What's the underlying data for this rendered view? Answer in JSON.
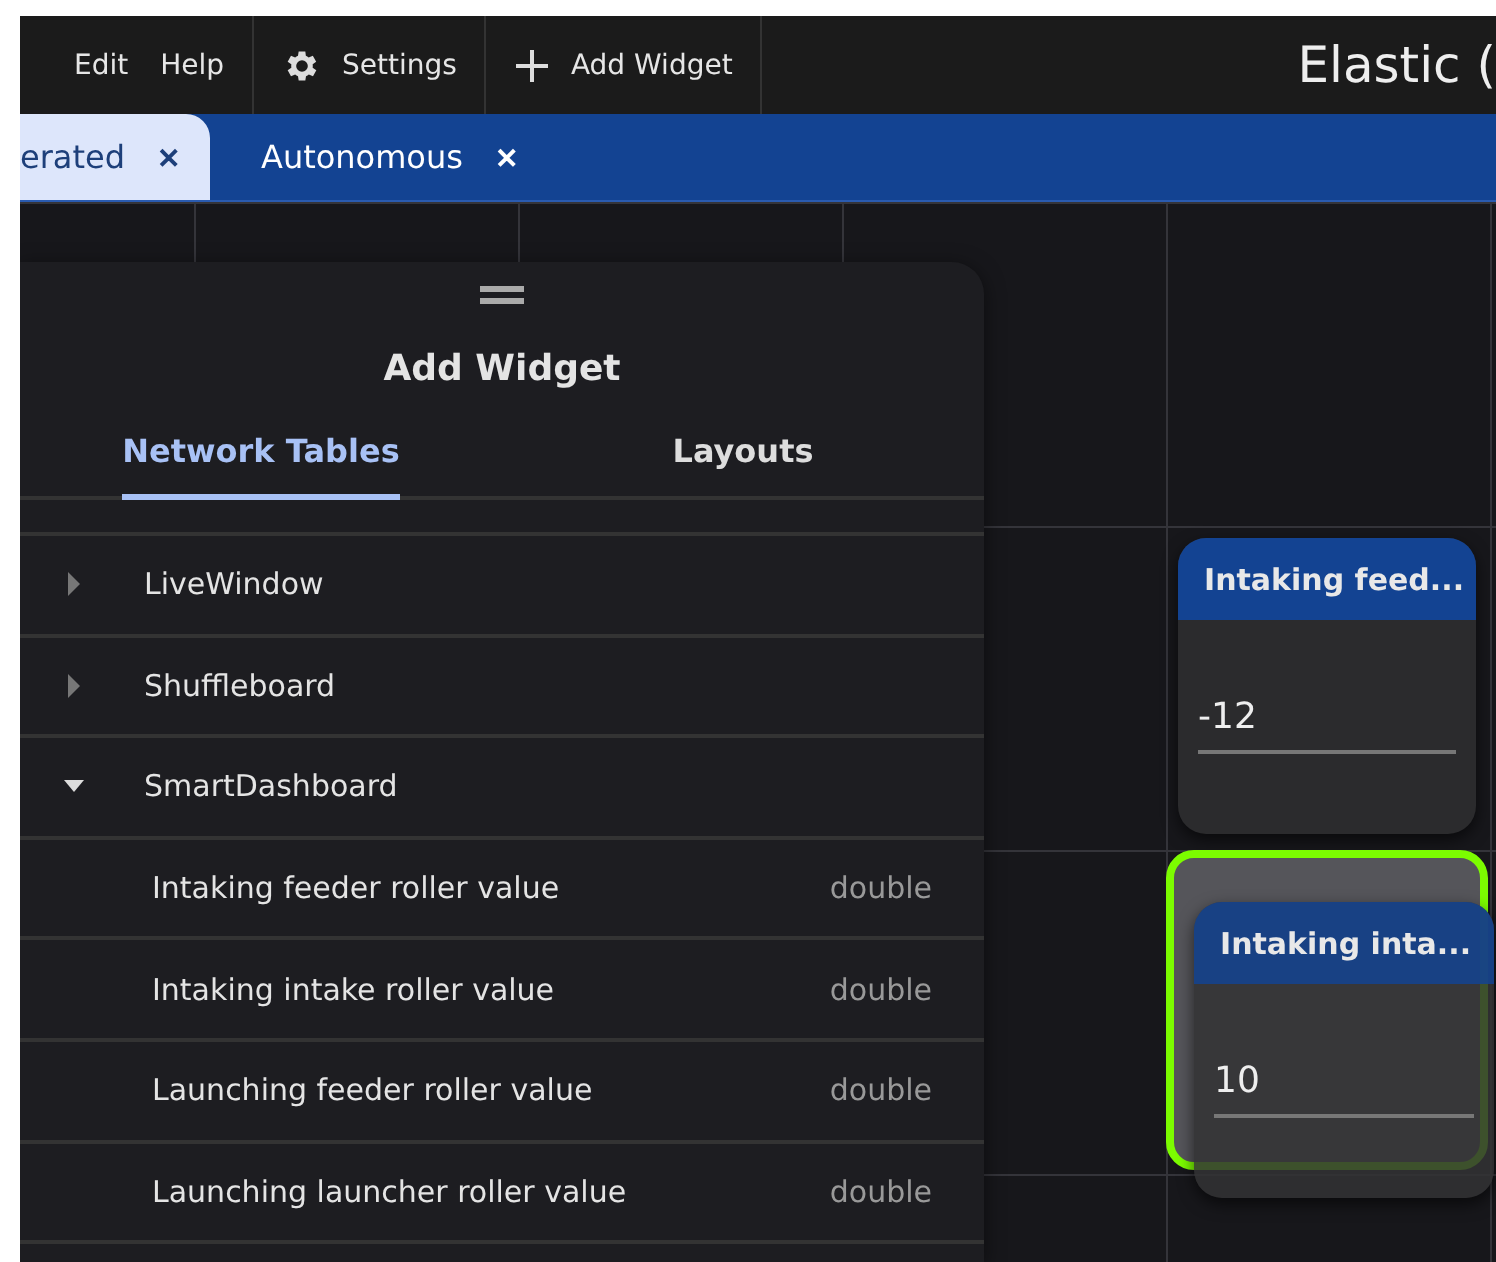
{
  "menu": [
    {
      "label": "Edit"
    },
    {
      "label": "Help"
    }
  ],
  "toolbar": [
    {
      "kind": "settings",
      "label": "Settings"
    },
    {
      "kind": "add",
      "label": "Add Widget"
    }
  ],
  "window": {
    "title": "Elastic ("
  },
  "tabs": [
    {
      "label": "erated",
      "close": "✕",
      "selected": true
    },
    {
      "label": "Autonomous",
      "close": "✕",
      "selected": false
    }
  ],
  "panel": {
    "title": "Add Widget",
    "tabs": [
      {
        "label": "Network Tables",
        "selected": true
      },
      {
        "label": "Layouts",
        "selected": false
      }
    ],
    "tree": [
      {
        "label": "LiveWindow",
        "expanded": false
      },
      {
        "label": "Shuffleboard",
        "expanded": false
      },
      {
        "label": "SmartDashboard",
        "expanded": true,
        "children": [
          {
            "label": "Intaking feeder roller value",
            "type": "double"
          },
          {
            "label": "Intaking intake roller value",
            "type": "double"
          },
          {
            "label": "Launching feeder roller value",
            "type": "double"
          },
          {
            "label": "Launching launcher roller value",
            "type": "double"
          }
        ]
      }
    ]
  },
  "widgets": [
    {
      "title": "Intaking feed...",
      "value": "-12",
      "dragging": false
    },
    {
      "title": "Intaking inta...",
      "value": "10",
      "dragging": true
    }
  ]
}
